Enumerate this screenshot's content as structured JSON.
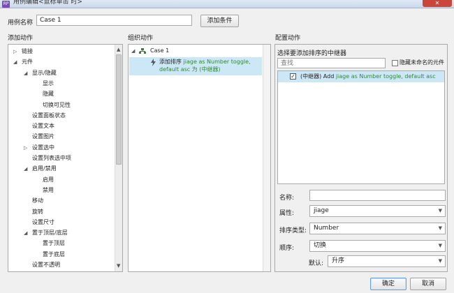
{
  "window": {
    "title": "用例编辑<鼠标单击 时>",
    "app_icon": "RP",
    "close_label": "✕"
  },
  "case": {
    "name_label": "用例名称",
    "name_value": "Case 1",
    "add_condition": "添加条件"
  },
  "sections": {
    "add_action": "添加动作",
    "organize_action": "组织动作",
    "config_action": "配置动作"
  },
  "action_tree": [
    {
      "label": "链接",
      "arrow": "▷"
    },
    {
      "label": "元件",
      "arrow": "◢"
    },
    {
      "label": "显示/隐藏",
      "arrow": "◢"
    },
    {
      "label": "显示"
    },
    {
      "label": "隐藏"
    },
    {
      "label": "切换可见性"
    },
    {
      "label": "设置面板状态"
    },
    {
      "label": "设置文本"
    },
    {
      "label": "设置图片"
    },
    {
      "label": "设置选中",
      "arrow": "▷"
    },
    {
      "label": "设置列表选中项"
    },
    {
      "label": "启用/禁用",
      "arrow": "◢"
    },
    {
      "label": "启用"
    },
    {
      "label": "禁用"
    },
    {
      "label": "移动"
    },
    {
      "label": "旋转"
    },
    {
      "label": "设置尺寸"
    },
    {
      "label": "置于顶层/底层",
      "arrow": "◢"
    },
    {
      "label": "置于顶层"
    },
    {
      "label": "置于底层"
    },
    {
      "label": "设置不透明"
    }
  ],
  "organize": {
    "case_label": "Case 1",
    "action_prefix": "添加排序 ",
    "action_detail": "jiage as Number toggle, default asc 为 (中继器)"
  },
  "config": {
    "choose_label": "选择要添加排序的中继器",
    "search_placeholder": "查找",
    "hide_unnamed_label": "隐藏未命名的元件",
    "repeater_item_prefix": "(中继器) Add ",
    "repeater_item_detail": "jiage as Number toggle, default asc",
    "repeater_checked": true,
    "hide_unnamed_checked": false,
    "name_label": "名称:",
    "name_value": "",
    "property_label": "属性:",
    "property_value": "jiage",
    "sort_type_label": "排序类型:",
    "sort_type_value": "Number",
    "order_label": "顺序:",
    "order_value": "切换",
    "default_label": "默认:",
    "default_value": "升序"
  },
  "footer": {
    "ok": "确定",
    "cancel": "取消"
  },
  "colors": {
    "selected_row": "#cce8f7",
    "green_text": "#2e8a2e",
    "close_red": "#c8463a"
  }
}
